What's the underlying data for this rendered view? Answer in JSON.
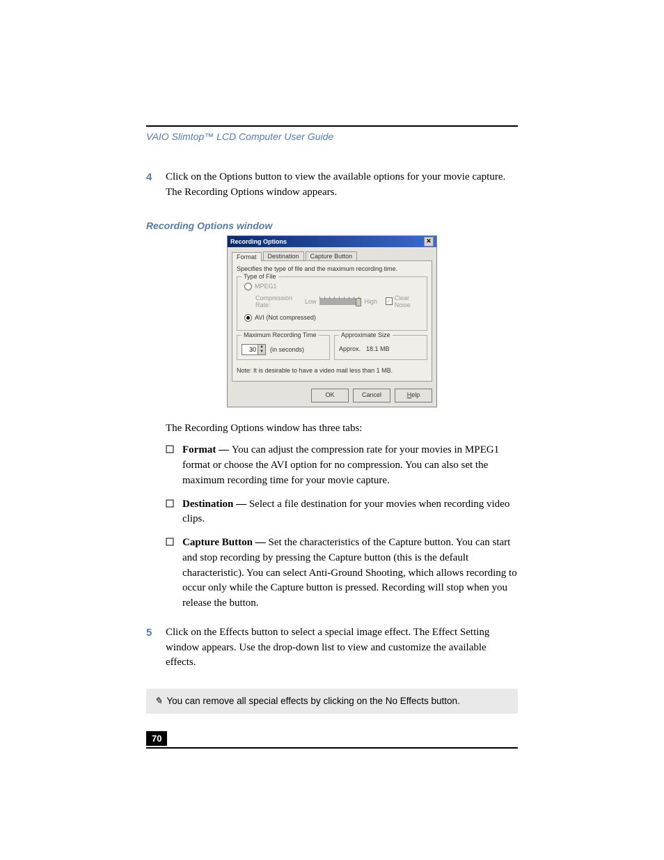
{
  "header": {
    "guide_title": "VAIO Slimtop™ LCD Computer User Guide"
  },
  "steps": {
    "s4": {
      "num": "4",
      "text": "Click on the Options button to view the available options for your movie capture. The Recording Options window appears."
    },
    "s5": {
      "num": "5",
      "text": "Click on the Effects button to select a special image effect. The Effect Setting window appears. Use the drop-down list to view and customize the available effects."
    }
  },
  "caption": "Recording Options window",
  "dialog": {
    "title": "Recording Options",
    "close": "✕",
    "tabs": {
      "format": "Format",
      "destination": "Destination",
      "capture": "Capture Button"
    },
    "desc": "Specifies the type of file and the maximum recording time.",
    "groups": {
      "type": "Type of File",
      "maxrec": "Maximum Recording Time",
      "approx": "Approximate Size"
    },
    "radios": {
      "mpeg1": "MPEG1",
      "avi": "AVI (Not compressed)"
    },
    "compression": {
      "label": "Compression Rate:",
      "low": "Low",
      "high": "High"
    },
    "clear_noise": "Clear Noise",
    "maxrec_value": "30",
    "maxrec_unit": "(in seconds)",
    "approx_prefix": "Approx.",
    "approx_value": "18.1 MB",
    "note": "Note: It is desirable to have a video mail less than 1 MB.",
    "buttons": {
      "ok": "OK",
      "cancel": "Cancel",
      "help": "Help",
      "help_u": "H"
    }
  },
  "after_screenshot": "The Recording Options window has three tabs:",
  "bullets": {
    "b1": {
      "title": "Format — ",
      "text": "You can adjust the compression rate for your movies in MPEG1 format or choose the AVI option for no compression. You can also set the maximum recording time for your movie capture."
    },
    "b2": {
      "title": "Destination — ",
      "text": "Select a file destination for your movies when recording video clips."
    },
    "b3": {
      "title": "Capture Button — ",
      "text": "Set the characteristics of the Capture button. You can start and stop recording by pressing the Capture button (this is the default characteristic). You can select Anti-Ground Shooting, which allows recording to occur only while the Capture button is pressed. Recording will stop when you release the button."
    }
  },
  "note_box": "You can remove all special effects by clicking on the No Effects button.",
  "page_number": "70"
}
